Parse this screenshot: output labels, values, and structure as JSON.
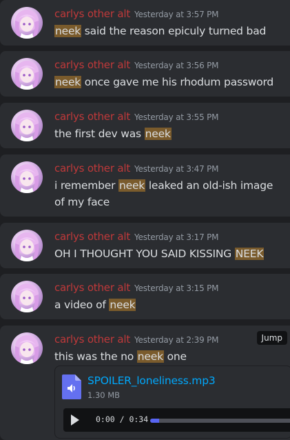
{
  "results": [
    {
      "author": "carlys other alt",
      "timestamp": "Yesterday at 3:57 PM",
      "segments": [
        {
          "text": "neek",
          "highlight": true
        },
        {
          "text": " said the reason epiculy turned bad",
          "highlight": false
        }
      ]
    },
    {
      "author": "carlys other alt",
      "timestamp": "Yesterday at 3:56 PM",
      "segments": [
        {
          "text": "neek",
          "highlight": true
        },
        {
          "text": " once gave me his rhodum password",
          "highlight": false
        }
      ]
    },
    {
      "author": "carlys other alt",
      "timestamp": "Yesterday at 3:55 PM",
      "segments": [
        {
          "text": "the first dev was ",
          "highlight": false
        },
        {
          "text": "neek",
          "highlight": true
        }
      ]
    },
    {
      "author": "carlys other alt",
      "timestamp": "Yesterday at 3:47 PM",
      "segments": [
        {
          "text": "i remember ",
          "highlight": false
        },
        {
          "text": "neek",
          "highlight": true
        },
        {
          "text": " leaked an old-ish image of my face",
          "highlight": false
        }
      ]
    },
    {
      "author": "carlys other alt",
      "timestamp": "Yesterday at 3:17 PM",
      "segments": [
        {
          "text": "OH I THOUGHT YOU SAID KISSING ",
          "highlight": false
        },
        {
          "text": "NEEK",
          "highlight": true
        }
      ]
    },
    {
      "author": "carlys other alt",
      "timestamp": "Yesterday at 3:15 PM",
      "segments": [
        {
          "text": "a video of ",
          "highlight": false
        },
        {
          "text": "neek",
          "highlight": true
        }
      ]
    },
    {
      "author": "carlys other alt",
      "timestamp": "Yesterday at 2:39 PM",
      "jump_label": "Jump",
      "segments": [
        {
          "text": "this was the no ",
          "highlight": false
        },
        {
          "text": "neek",
          "highlight": true
        },
        {
          "text": " one",
          "highlight": false
        }
      ],
      "attachment": {
        "file_name": "SPOILER_loneliness.mp3",
        "file_size": "1.30 MB",
        "time_display": "0:00 / 0:34",
        "progress": 0.06
      }
    }
  ],
  "colors": {
    "author": "#c0393a",
    "highlight": "#7a5b2c",
    "link": "#00a8fc",
    "card": "#2b2d31",
    "background": "#1e1f22"
  },
  "icons": [
    "avatar",
    "audio-file-icon",
    "play-icon"
  ]
}
